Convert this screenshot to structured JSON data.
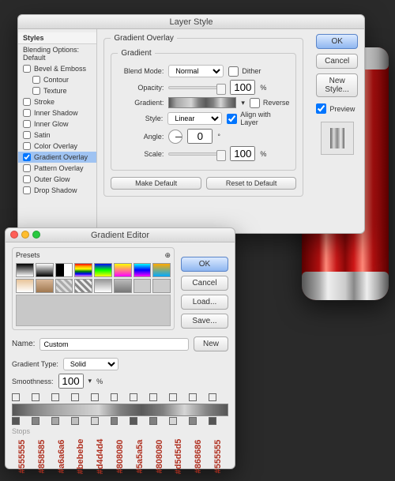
{
  "layer_style": {
    "title": "Layer Style",
    "side": {
      "header": "Styles",
      "options_label": "Blending Options: Default",
      "items": [
        {
          "label": "Bevel & Emboss",
          "checked": false,
          "indent": false
        },
        {
          "label": "Contour",
          "checked": false,
          "indent": true
        },
        {
          "label": "Texture",
          "checked": false,
          "indent": true
        },
        {
          "label": "Stroke",
          "checked": false,
          "indent": false
        },
        {
          "label": "Inner Shadow",
          "checked": false,
          "indent": false
        },
        {
          "label": "Inner Glow",
          "checked": false,
          "indent": false
        },
        {
          "label": "Satin",
          "checked": false,
          "indent": false
        },
        {
          "label": "Color Overlay",
          "checked": false,
          "indent": false
        },
        {
          "label": "Gradient Overlay",
          "checked": true,
          "indent": false,
          "selected": true
        },
        {
          "label": "Pattern Overlay",
          "checked": false,
          "indent": false
        },
        {
          "label": "Outer Glow",
          "checked": false,
          "indent": false
        },
        {
          "label": "Drop Shadow",
          "checked": false,
          "indent": false
        }
      ]
    },
    "panel": {
      "group_label": "Gradient Overlay",
      "subgroup_label": "Gradient",
      "blend_mode_label": "Blend Mode:",
      "blend_mode_value": "Normal",
      "dither_label": "Dither",
      "dither_checked": false,
      "opacity_label": "Opacity:",
      "opacity_value": "100",
      "opacity_unit": "%",
      "gradient_label": "Gradient:",
      "reverse_label": "Reverse",
      "reverse_checked": false,
      "style_label": "Style:",
      "style_value": "Linear",
      "align_label": "Align with Layer",
      "align_checked": true,
      "angle_label": "Angle:",
      "angle_value": "0",
      "angle_unit": "°",
      "scale_label": "Scale:",
      "scale_value": "100",
      "scale_unit": "%",
      "make_default": "Make Default",
      "reset_default": "Reset to Default"
    },
    "buttons": {
      "ok": "OK",
      "cancel": "Cancel",
      "new_style": "New Style...",
      "preview": "Preview",
      "preview_checked": true
    }
  },
  "gradient_editor": {
    "title": "Gradient Editor",
    "presets_label": "Presets",
    "buttons": {
      "ok": "OK",
      "cancel": "Cancel",
      "load": "Load...",
      "save": "Save...",
      "new": "New"
    },
    "name_label": "Name:",
    "name_value": "Custom",
    "type_label": "Gradient Type:",
    "type_value": "Solid",
    "smooth_label": "Smoothness:",
    "smooth_value": "100",
    "smooth_unit": "%",
    "stops_label": "Stops",
    "stops": [
      "#555555",
      "#858585",
      "#a6a6a6",
      "#bebebe",
      "#d4d4d4",
      "#808080",
      "#5a5a5a",
      "#808080",
      "#d5d5d5",
      "#868686",
      "#555555"
    ]
  }
}
